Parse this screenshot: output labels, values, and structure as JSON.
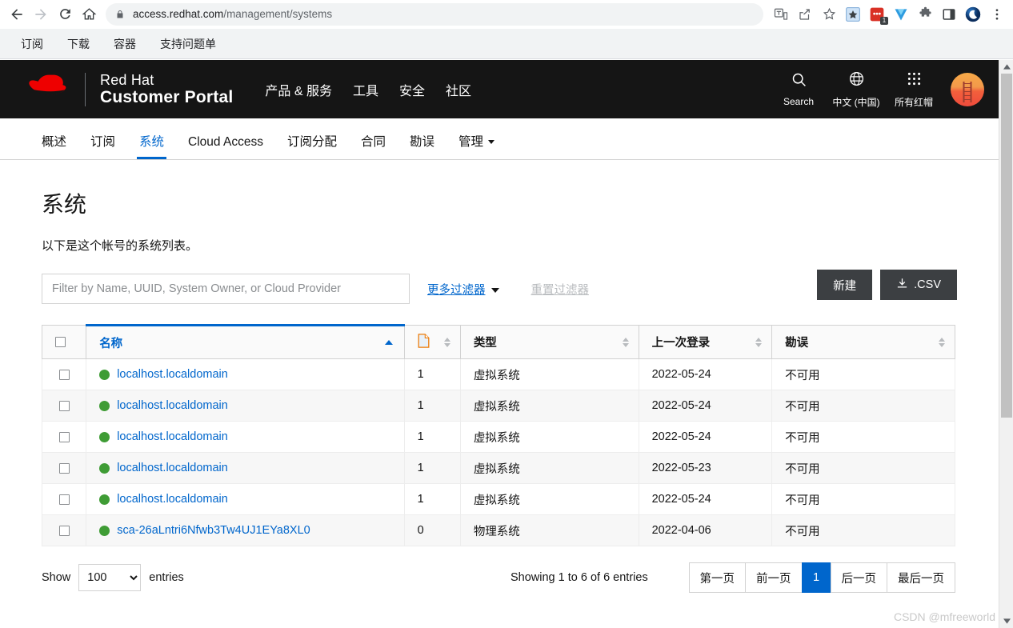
{
  "browser": {
    "url_host": "access.redhat.com",
    "url_path": "/management/systems",
    "back_icon": "back-arrow-icon",
    "forward_icon": "forward-arrow-icon",
    "reload_icon": "reload-icon",
    "home_icon": "home-icon",
    "lock_icon": "lock-icon",
    "translate_icon": "translate-icon",
    "share_icon": "share-icon",
    "bookmark_icon": "star-outline-icon",
    "ext_star_icon": "extension-star-icon",
    "ext_red_icon": "extension-red-icon",
    "ext_red_badge": "1",
    "ext_v_icon": "extension-v-icon",
    "ext_puzzle_icon": "extension-puzzle-icon",
    "ext_panel_icon": "side-panel-icon",
    "profile_icon": "profile-moon-icon",
    "menu_icon": "three-dot-menu-icon"
  },
  "bookmarks": [
    {
      "label": "订阅"
    },
    {
      "label": "下载"
    },
    {
      "label": "容器"
    },
    {
      "label": "支持问题单"
    }
  ],
  "masthead": {
    "logo_icon": "red-hat-fedora-logo",
    "brand_line1": "Red Hat",
    "brand_line2": "Customer Portal",
    "nav": [
      {
        "label": "产品 & 服务"
      },
      {
        "label": "工具"
      },
      {
        "label": "安全"
      },
      {
        "label": "社区"
      }
    ],
    "search": {
      "icon": "search-icon",
      "label": "Search"
    },
    "language": {
      "icon": "globe-icon",
      "label": "中文 (中国)"
    },
    "all_redhat": {
      "icon": "grid-apps-icon",
      "label": "所有红帽"
    },
    "avatar": {
      "icon": "user-avatar-ladder"
    },
    "bg_color": "#151515"
  },
  "subnav": {
    "tabs": [
      {
        "label": "概述",
        "active": false,
        "caret": false
      },
      {
        "label": "订阅",
        "active": false,
        "caret": false
      },
      {
        "label": "系统",
        "active": true,
        "caret": false
      },
      {
        "label": "Cloud Access",
        "active": false,
        "caret": false
      },
      {
        "label": "订阅分配",
        "active": false,
        "caret": false
      },
      {
        "label": "合同",
        "active": false,
        "caret": false
      },
      {
        "label": "勘误",
        "active": false,
        "caret": false
      },
      {
        "label": "管理",
        "active": false,
        "caret": true
      }
    ],
    "active_color": "#0066cc"
  },
  "page": {
    "title": "系统",
    "description": "以下是这个帐号的系统列表。"
  },
  "filters": {
    "input_placeholder": "Filter by Name, UUID, System Owner, or Cloud Provider",
    "input_value": "",
    "more_filters_label": "更多过滤器",
    "reset_filters_label": "重置过滤器",
    "new_button_label": "新建",
    "csv_button_label": ".CSV",
    "csv_icon": "download-icon"
  },
  "table": {
    "columns": [
      {
        "key": "checkbox",
        "label": "",
        "sortable": false
      },
      {
        "key": "name",
        "label": "名称",
        "sortable": true,
        "sorted": "asc"
      },
      {
        "key": "doc",
        "label": "",
        "icon": "document-icon",
        "sortable": true
      },
      {
        "key": "type",
        "label": "类型",
        "sortable": true
      },
      {
        "key": "last_login",
        "label": "上一次登录",
        "sortable": true
      },
      {
        "key": "errata",
        "label": "勘误",
        "sortable": true
      }
    ],
    "rows": [
      {
        "status": "green",
        "name": "localhost.localdomain",
        "doc": "1",
        "type": "虚拟系统",
        "last_login": "2022-05-24",
        "errata": "不可用"
      },
      {
        "status": "green",
        "name": "localhost.localdomain",
        "doc": "1",
        "type": "虚拟系统",
        "last_login": "2022-05-24",
        "errata": "不可用"
      },
      {
        "status": "green",
        "name": "localhost.localdomain",
        "doc": "1",
        "type": "虚拟系统",
        "last_login": "2022-05-24",
        "errata": "不可用"
      },
      {
        "status": "green",
        "name": "localhost.localdomain",
        "doc": "1",
        "type": "虚拟系统",
        "last_login": "2022-05-23",
        "errata": "不可用"
      },
      {
        "status": "green",
        "name": "localhost.localdomain",
        "doc": "1",
        "type": "虚拟系统",
        "last_login": "2022-05-24",
        "errata": "不可用"
      },
      {
        "status": "green",
        "name": "sca-26aLntri6Nfwb3Tw4UJ1EYa8XL0",
        "doc": "0",
        "type": "物理系统",
        "last_login": "2022-04-06",
        "errata": "不可用"
      }
    ],
    "status_color": "#3f9c35",
    "link_color": "#0066cc"
  },
  "footer": {
    "show_label": "Show",
    "entries_label": "entries",
    "per_page_value": "100",
    "per_page_options": [
      "100"
    ],
    "showing_text": "Showing 1 to 6 of 6 entries",
    "pager": [
      {
        "label": "第一页",
        "current": false
      },
      {
        "label": "前一页",
        "current": false
      },
      {
        "label": "1",
        "current": true
      },
      {
        "label": "后一页",
        "current": false
      },
      {
        "label": "最后一页",
        "current": false
      }
    ]
  },
  "watermark": "CSDN @mfreeworld"
}
